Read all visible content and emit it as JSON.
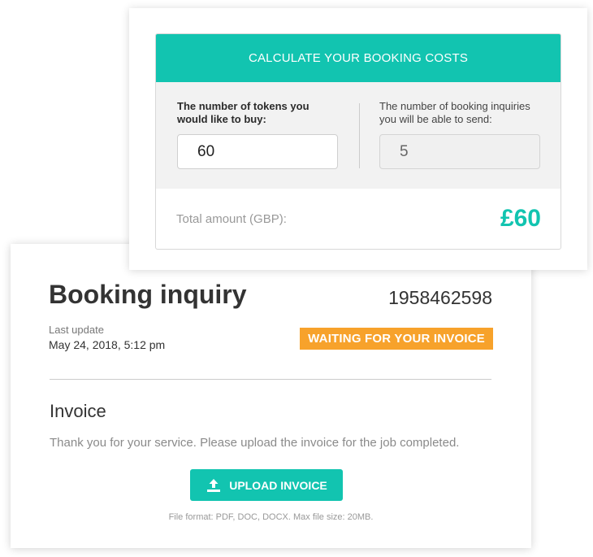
{
  "calculator": {
    "header": "CALCULATE YOUR BOOKING COSTS",
    "tokens_label": "The number of tokens you would like to buy:",
    "tokens_value": "60",
    "inquiries_label": "The number of booking inquiries you will be able to send:",
    "inquiries_value": "5",
    "total_label": "Total amount (GBP):",
    "total_value": "£60"
  },
  "booking": {
    "title": "Booking inquiry",
    "id": "1958462598",
    "last_update_label": "Last update",
    "last_update_value": "May 24, 2018, 5:12 pm",
    "status": "WAITING FOR YOUR INVOICE",
    "section_title": "Invoice",
    "description": "Thank you for your service. Please upload the invoice for the job completed.",
    "upload_button": "UPLOAD INVOICE",
    "upload_icon": "upload-icon",
    "file_info": "File format: PDF, DOC, DOCX. Max file size: 20MB."
  },
  "colors": {
    "accent": "#12c4b0",
    "status": "#f7a22b"
  }
}
